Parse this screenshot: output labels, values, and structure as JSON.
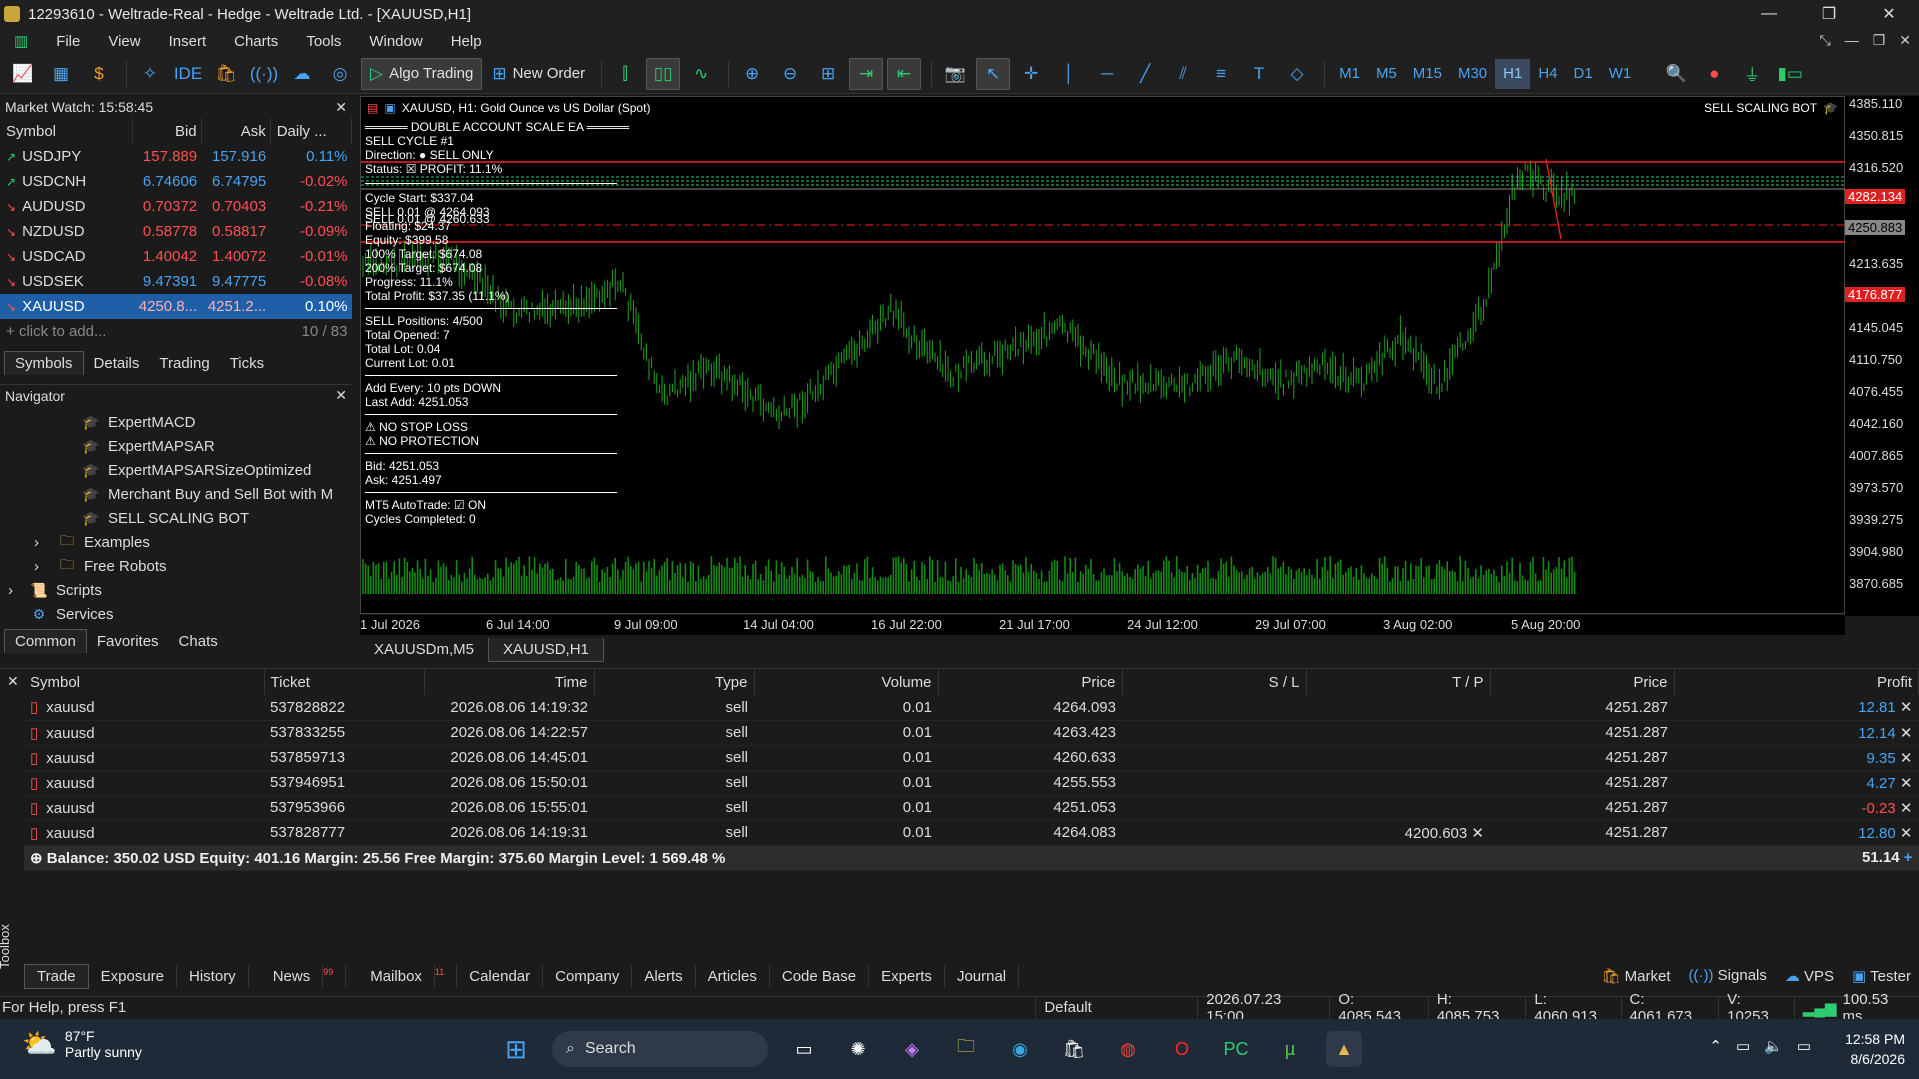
{
  "window": {
    "title": "12293610 - Weltrade-Real - Hedge - Weltrade Ltd. - [XAUUSD,H1]"
  },
  "menu": [
    "File",
    "View",
    "Insert",
    "Charts",
    "Tools",
    "Window",
    "Help"
  ],
  "toolbar": {
    "algo_trading": "Algo Trading",
    "new_order": "New Order",
    "ide": "IDE",
    "timeframes": [
      "M1",
      "M5",
      "M15",
      "M30",
      "H1",
      "H4",
      "D1",
      "W1"
    ],
    "active_tf": "H1"
  },
  "market_watch": {
    "title": "Market Watch: 15:58:45",
    "columns": [
      "Symbol",
      "Bid",
      "Ask",
      "Daily ..."
    ],
    "rows": [
      {
        "symbol": "USDJPY",
        "bid": "157.889",
        "ask": "157.916",
        "chg": "0.11%",
        "dir": "up"
      },
      {
        "symbol": "USDCNH",
        "bid": "6.74606",
        "ask": "6.74795",
        "chg": "-0.02%",
        "dir": "up"
      },
      {
        "symbol": "AUDUSD",
        "bid": "0.70372",
        "ask": "0.70403",
        "chg": "-0.21%",
        "dir": "down"
      },
      {
        "symbol": "NZDUSD",
        "bid": "0.58778",
        "ask": "0.58817",
        "chg": "-0.09%",
        "dir": "down"
      },
      {
        "symbol": "USDCAD",
        "bid": "1.40042",
        "ask": "1.40072",
        "chg": "-0.01%",
        "dir": "down"
      },
      {
        "symbol": "USDSEK",
        "bid": "9.47391",
        "ask": "9.47775",
        "chg": "-0.08%",
        "dir": "down"
      },
      {
        "symbol": "XAUUSD",
        "bid": "4250.8...",
        "ask": "4251.2...",
        "chg": "0.10%",
        "dir": "down"
      }
    ],
    "add_hint": "click to add...",
    "count": "10 / 83",
    "tabs": [
      "Symbols",
      "Details",
      "Trading",
      "Ticks"
    ]
  },
  "navigator": {
    "title": "Navigator",
    "items": [
      "ExpertMACD",
      "ExpertMAPSAR",
      "ExpertMAPSARSizeOptimized",
      "Merchant Buy and Sell Bot with M",
      "SELL SCALING BOT",
      "Examples",
      "Free Robots",
      "Scripts",
      "Services"
    ],
    "tabs": [
      "Common",
      "Favorites",
      "Chats"
    ]
  },
  "chart": {
    "header": "XAUUSD, H1:  Gold Ounce vs US Dollar (Spot)",
    "ea_label": "SELL SCALING BOT",
    "price_ticks": [
      "4385.110",
      "4350.815",
      "4316.520",
      "4282.134",
      "4250.883",
      "4213.635",
      "4176.877",
      "4145.045",
      "4110.750",
      "4076.455",
      "4042.160",
      "4007.865",
      "3973.570",
      "3939.275",
      "3904.980",
      "3870.685"
    ],
    "time_ticks": [
      "1 Jul 2026",
      "6 Jul 14:00",
      "9 Jul 09:00",
      "14 Jul 04:00",
      "16 Jul 22:00",
      "21 Jul 17:00",
      "24 Jul 12:00",
      "29 Jul 07:00",
      "3 Aug 02:00",
      "5 Aug 20:00"
    ],
    "tabs": [
      "XAUUSDm,M5",
      "XAUUSD,H1"
    ],
    "overlay": {
      "title": "DOUBLE ACCOUNT SCALE EA",
      "lines1": [
        "SELL CYCLE #1",
        "Direction: ● SELL ONLY",
        "Status: ☒ PROFIT: 11.1%"
      ],
      "lines2": [
        "Cycle Start: $337.04",
        "SELL 0.01 @ 4264.093",
        "SELL 0.01 @ 4260.633",
        "Floating: $24.37",
        "Equity: $399.58",
        "100% Target: $674.08",
        "200% Target: $674.08",
        "Progress: 11.1%",
        "Total Profit: $37.35 (11.1%)"
      ],
      "lines3": [
        "SELL Positions: 4/500",
        "Total Opened: 7",
        "Total Lot: 0.04",
        "Current Lot: 0.01"
      ],
      "lines4": [
        "Add Every: 10 pts DOWN",
        "Last Add: 4251.053"
      ],
      "lines5": [
        "⚠ NO STOP LOSS",
        "⚠ NO PROTECTION"
      ],
      "lines6": [
        "Bid: 4251.053",
        "Ask: 4251.497"
      ],
      "lines7": [
        "MT5 AutoTrade: ☑ ON",
        "Cycles Completed: 0"
      ]
    }
  },
  "trade": {
    "columns": [
      "Symbol",
      "Ticket",
      "Time",
      "Type",
      "Volume",
      "Price",
      "S / L",
      "T / P",
      "Price",
      "Profit"
    ],
    "rows": [
      {
        "symbol": "xauusd",
        "ticket": "537828822",
        "time": "2026.08.06 14:19:32",
        "type": "sell",
        "volume": "0.01",
        "price": "4264.093",
        "sl": "",
        "tp": "",
        "cur": "4251.287",
        "profit": "12.81"
      },
      {
        "symbol": "xauusd",
        "ticket": "537833255",
        "time": "2026.08.06 14:22:57",
        "type": "sell",
        "volume": "0.01",
        "price": "4263.423",
        "sl": "",
        "tp": "",
        "cur": "4251.287",
        "profit": "12.14"
      },
      {
        "symbol": "xauusd",
        "ticket": "537859713",
        "time": "2026.08.06 14:45:01",
        "type": "sell",
        "volume": "0.01",
        "price": "4260.633",
        "sl": "",
        "tp": "",
        "cur": "4251.287",
        "profit": "9.35"
      },
      {
        "symbol": "xauusd",
        "ticket": "537946951",
        "time": "2026.08.06 15:50:01",
        "type": "sell",
        "volume": "0.01",
        "price": "4255.553",
        "sl": "",
        "tp": "",
        "cur": "4251.287",
        "profit": "4.27"
      },
      {
        "symbol": "xauusd",
        "ticket": "537953966",
        "time": "2026.08.06 15:55:01",
        "type": "sell",
        "volume": "0.01",
        "price": "4251.053",
        "sl": "",
        "tp": "",
        "cur": "4251.287",
        "profit": "-0.23"
      },
      {
        "symbol": "xauusd",
        "ticket": "537828777",
        "time": "2026.08.06 14:19:31",
        "type": "sell",
        "volume": "0.01",
        "price": "4264.083",
        "sl": "",
        "tp": "4200.603",
        "cur": "4251.287",
        "profit": "12.80"
      }
    ],
    "summary": "Balance: 350.02 USD  Equity: 401.16  Margin: 25.56  Free Margin: 375.60  Margin Level: 1 569.48 %",
    "total": "51.14"
  },
  "toolbox": {
    "label": "Toolbox",
    "tabs": [
      "Trade",
      "Exposure",
      "History",
      "News",
      "Mailbox",
      "Calendar",
      "Company",
      "Alerts",
      "Articles",
      "Code Base",
      "Experts",
      "Journal"
    ],
    "news_count": "99",
    "mail_count": "11",
    "right": [
      "Market",
      "Signals",
      "VPS",
      "Tester"
    ]
  },
  "status": {
    "help": "For Help, press F1",
    "profile": "Default",
    "time": "2026.07.23 15:00",
    "o": "O: 4085.543",
    "h": "H: 4085.753",
    "l": "L: 4060.913",
    "c": "C: 4061.673",
    "v": "V: 10253",
    "ping": "100.53 ms"
  },
  "taskbar": {
    "temp": "87°F",
    "weather": "Partly sunny",
    "search": "Search",
    "time": "12:58 PM",
    "date": "8/6/2026"
  }
}
